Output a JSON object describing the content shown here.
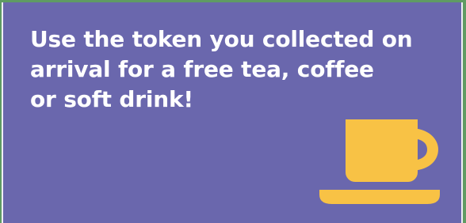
{
  "message": {
    "lines": [
      "Use the token you collected on",
      "arrival for a free tea, coffee",
      "or soft drink!"
    ]
  },
  "icon": {
    "name": "coffee-cup-icon",
    "color": "#f8c245"
  },
  "colors": {
    "panel_background": "#6a67ad",
    "text": "#ffffff",
    "outer_background": "#5f9b63"
  }
}
